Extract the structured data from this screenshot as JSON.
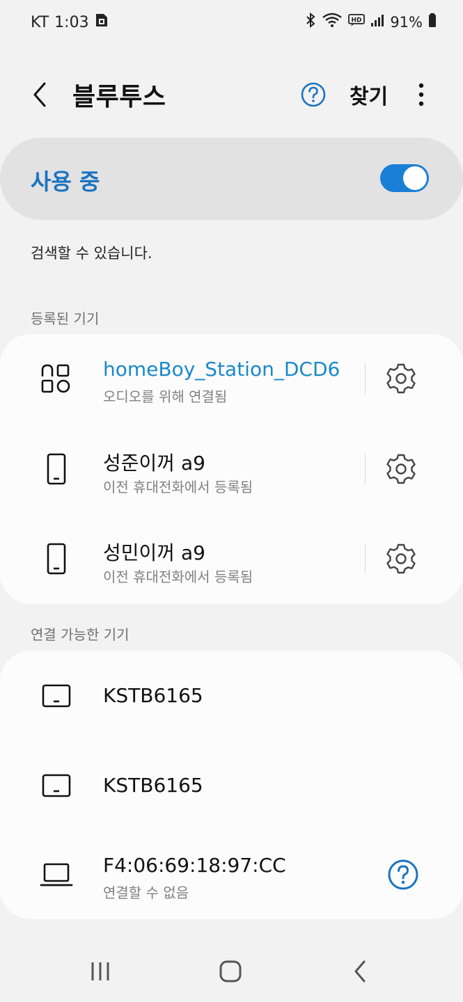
{
  "status_bar": {
    "carrier": "KT",
    "time": "1:03",
    "battery_percent": "91%",
    "icons": [
      "sim-card-icon",
      "bluetooth-icon",
      "wifi-icon",
      "hd-voice-icon",
      "signal-icon",
      "battery-icon"
    ]
  },
  "app_bar": {
    "title": "블루투스",
    "scan_label": "찾기",
    "icons": [
      "back-arrow-icon",
      "help-circle-icon",
      "more-vert-icon"
    ]
  },
  "master": {
    "label": "사용 중",
    "enabled": true,
    "accent_color": "#1a7fd6"
  },
  "info_text": "검색할 수 있습니다.",
  "paired": {
    "header": "등록된 기기",
    "devices": [
      {
        "name": "homeBoy_Station_DCD6",
        "status": "오디오를 위해 연결됨",
        "icon": "smart-home-icon",
        "connected": true
      },
      {
        "name": "성준이꺼 a9",
        "status": "이전 휴대전화에서 등록됨",
        "icon": "phone-icon",
        "connected": false
      },
      {
        "name": "성민이꺼 a9",
        "status": "이전 휴대전화에서 등록됨",
        "icon": "phone-icon",
        "connected": false
      }
    ]
  },
  "available": {
    "header": "연결 가능한 기기",
    "devices": [
      {
        "name": "KSTB6165",
        "status": "",
        "icon": "tv-icon"
      },
      {
        "name": "KSTB6165",
        "status": "",
        "icon": "tv-icon"
      },
      {
        "name": "F4:06:69:18:97:CC",
        "status": "연결할 수 없음",
        "icon": "laptop-icon"
      }
    ]
  },
  "nav_bar": {
    "icons": [
      "recents-icon",
      "home-icon",
      "nav-back-icon"
    ]
  },
  "colors": {
    "accent": "#1a73c1",
    "connected_text": "#1a88c9",
    "background": "#f2f2f2"
  }
}
